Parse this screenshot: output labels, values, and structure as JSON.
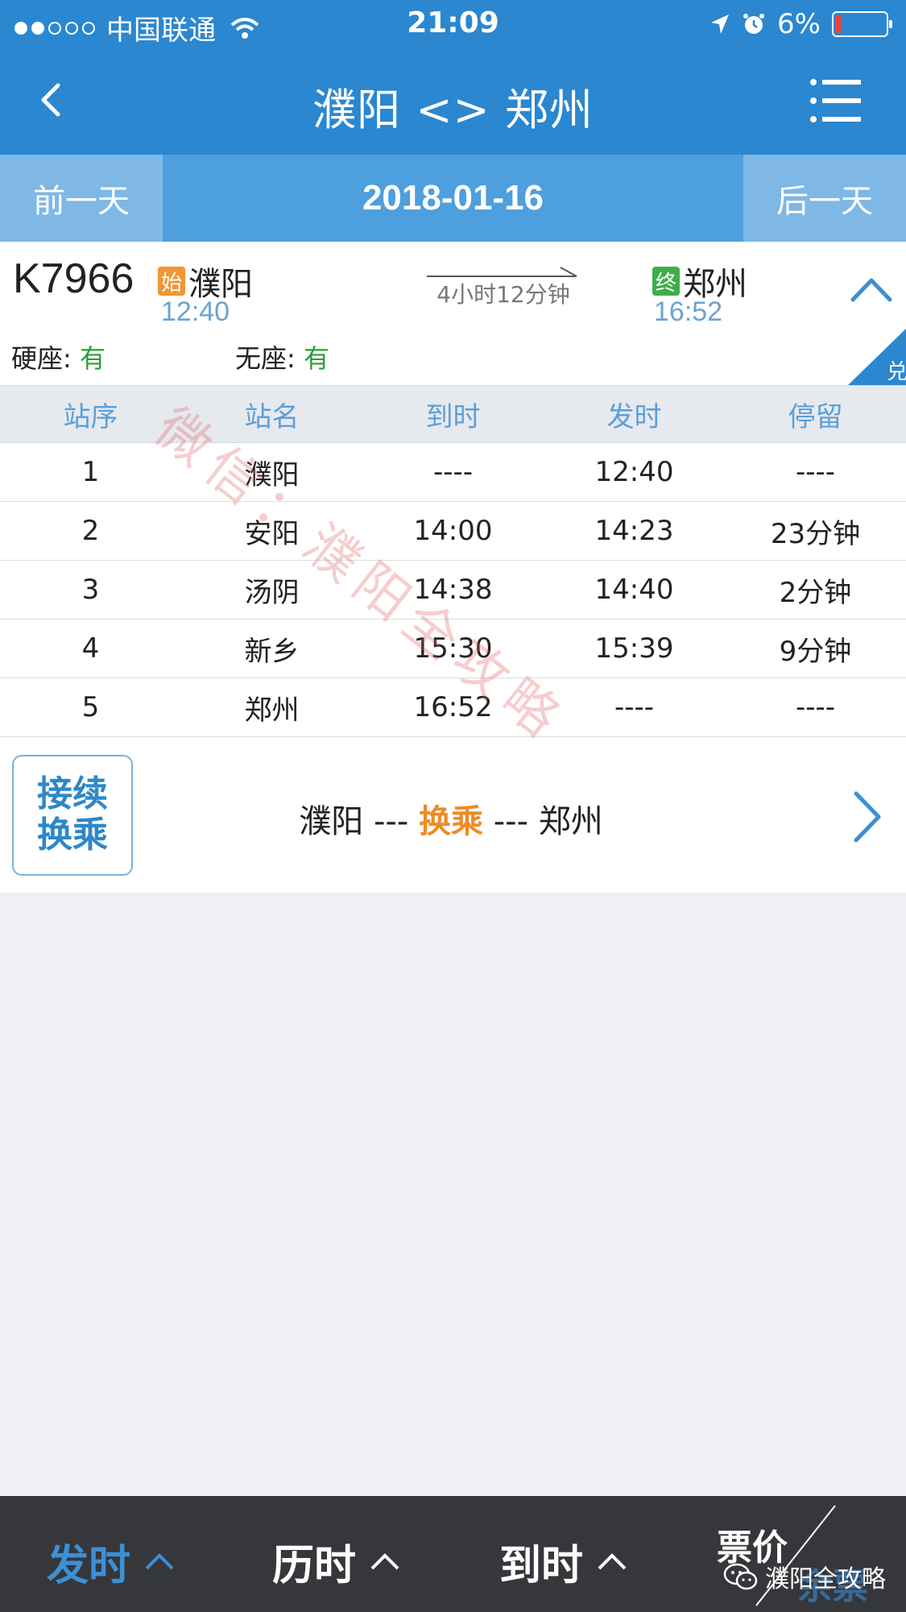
{
  "status_bar": {
    "carrier": "中国联通",
    "time": "21:09",
    "battery": "6%",
    "signal_strength": 2
  },
  "header": {
    "title": "濮阳 <> 郑州",
    "back_icon": "chevron-left-icon",
    "menu_icon": "menu-icon"
  },
  "date_bar": {
    "prev_label": "前一天",
    "date": "2018-01-16",
    "next_label": "后一天"
  },
  "train": {
    "number": "K7966",
    "from_tag": "始",
    "from_station": "濮阳",
    "from_time": "12:40",
    "duration": "4小时12分钟",
    "to_tag": "终",
    "to_station": "郑州",
    "to_time": "16:52",
    "seats": [
      {
        "label": "硬座",
        "value": "有"
      },
      {
        "label": "无座",
        "value": "有"
      }
    ],
    "corner_badge": "兑"
  },
  "stops_table": {
    "headers": [
      "站序",
      "站名",
      "到时",
      "发时",
      "停留"
    ],
    "rows": [
      [
        "1",
        "濮阳",
        "----",
        "12:40",
        "----"
      ],
      [
        "2",
        "安阳",
        "14:00",
        "14:23",
        "23分钟"
      ],
      [
        "3",
        "汤阴",
        "14:38",
        "14:40",
        "2分钟"
      ],
      [
        "4",
        "新乡",
        "15:30",
        "15:39",
        "9分钟"
      ],
      [
        "5",
        "郑州",
        "16:52",
        "----",
        "----"
      ]
    ]
  },
  "transfer": {
    "button_line1": "接续",
    "button_line2": "换乘",
    "route_from": "濮阳 --- ",
    "route_mid": "换乘",
    "route_to": " --- 郑州"
  },
  "watermark": "微信：濮阳全攻略",
  "tab_bar": {
    "depart": "发时",
    "duration": "历时",
    "arrive": "到时",
    "price": "票价",
    "remaining": "余票",
    "active": "depart"
  },
  "brand_watermark": "濮阳全攻略",
  "colors": {
    "primary": "#2b87cf",
    "date_bar": "#4d9fdd",
    "accent_orange": "#f08b24",
    "available_green": "#2a9d3a",
    "tab_bar": "#35373b"
  }
}
